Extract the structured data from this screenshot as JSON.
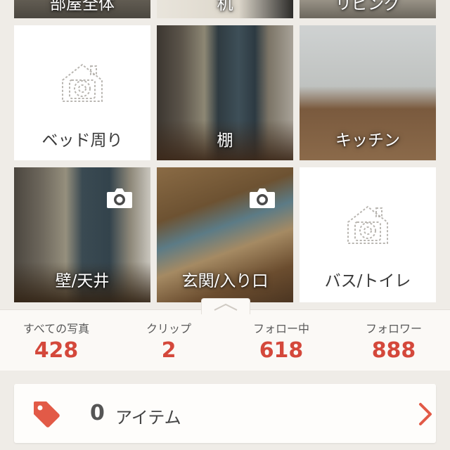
{
  "tiles": {
    "top_partial": [
      {
        "label": "部屋全体"
      },
      {
        "label": "机"
      },
      {
        "label": "リビング"
      }
    ],
    "bed": {
      "label": "ベッド周り"
    },
    "shelf": {
      "label": "棚"
    },
    "kitchen": {
      "label": "キッチン"
    },
    "wall": {
      "label": "壁/天井"
    },
    "entrance": {
      "label": "玄関/入り口"
    },
    "bath": {
      "label": "バス/トイレ"
    }
  },
  "stats": [
    {
      "label": "すべての写真",
      "value": "428"
    },
    {
      "label": "クリップ",
      "value": "2"
    },
    {
      "label": "フォロー中",
      "value": "618"
    },
    {
      "label": "フォロワー",
      "value": "888"
    }
  ],
  "items": {
    "count": "0",
    "label": "アイテム"
  },
  "colors": {
    "accent": "#d4483b",
    "tag": "#e25a47",
    "background": "#efece7",
    "panel": "#fbf9f6"
  },
  "icons": {
    "placeholder": "house-camera-icon",
    "photo_badge": "camera-icon",
    "tag": "tag-icon",
    "chevron": "chevron-right-icon",
    "handle": "chevron-up-icon"
  }
}
